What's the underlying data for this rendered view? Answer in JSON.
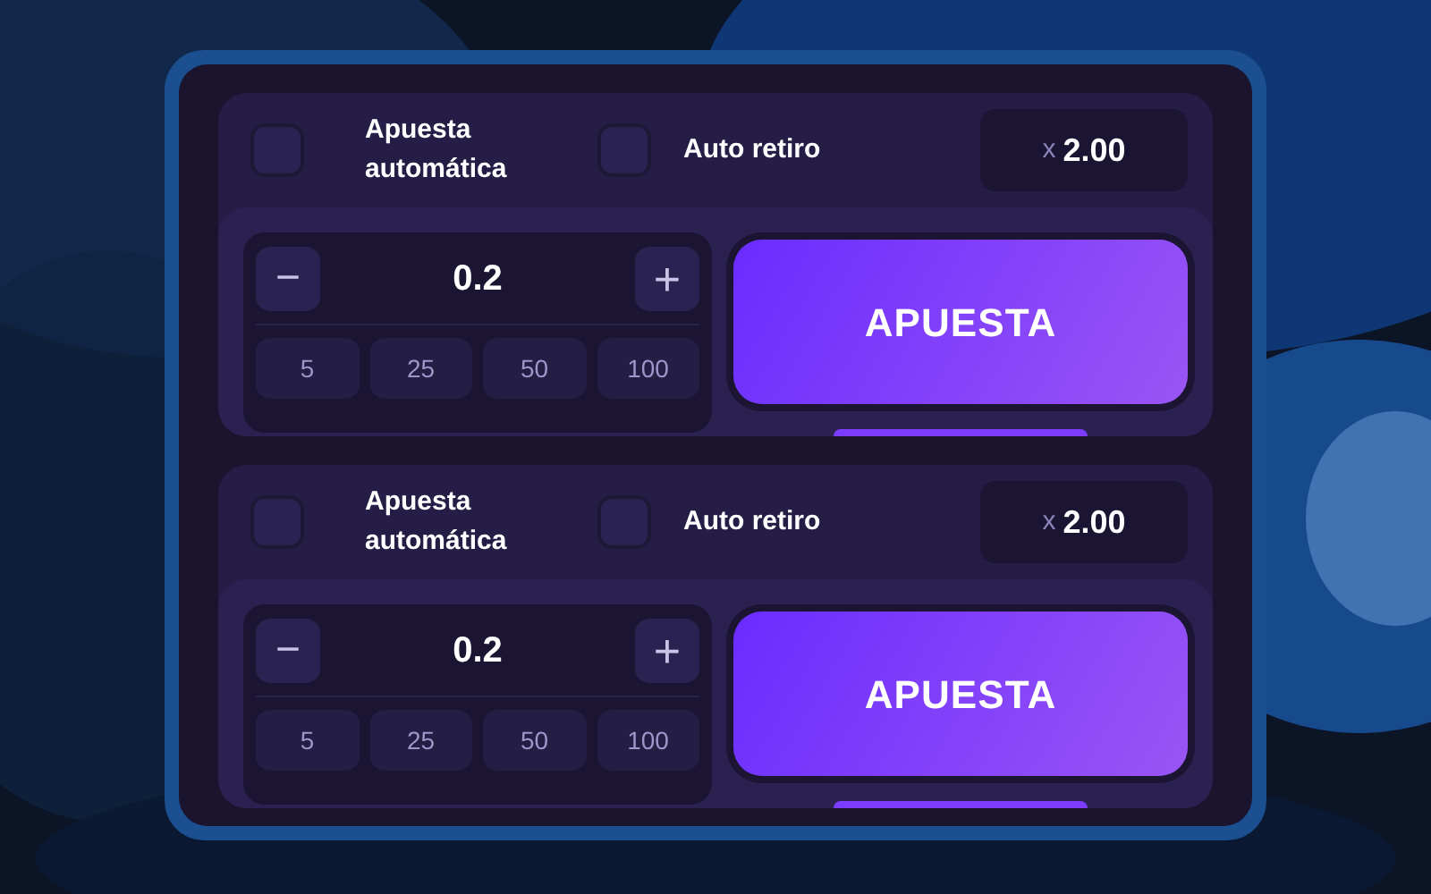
{
  "bet_panels": [
    {
      "auto_bet": {
        "label": "Apuesta automática",
        "checked": false
      },
      "auto_cashout": {
        "label": "Auto retiro",
        "checked": false
      },
      "multiplier": {
        "prefix": "x",
        "value": "2.00"
      },
      "stake": {
        "minus": "−",
        "value": "0.2",
        "plus": "+"
      },
      "quick_amounts": [
        "5",
        "25",
        "50",
        "100"
      ],
      "bet_button": "APUESTA"
    },
    {
      "auto_bet": {
        "label": "Apuesta automática",
        "checked": false
      },
      "auto_cashout": {
        "label": "Auto retiro",
        "checked": false
      },
      "multiplier": {
        "prefix": "x",
        "value": "2.00"
      },
      "stake": {
        "minus": "−",
        "value": "0.2",
        "plus": "+"
      },
      "quick_amounts": [
        "5",
        "25",
        "50",
        "100"
      ],
      "bet_button": "APUESTA"
    }
  ]
}
